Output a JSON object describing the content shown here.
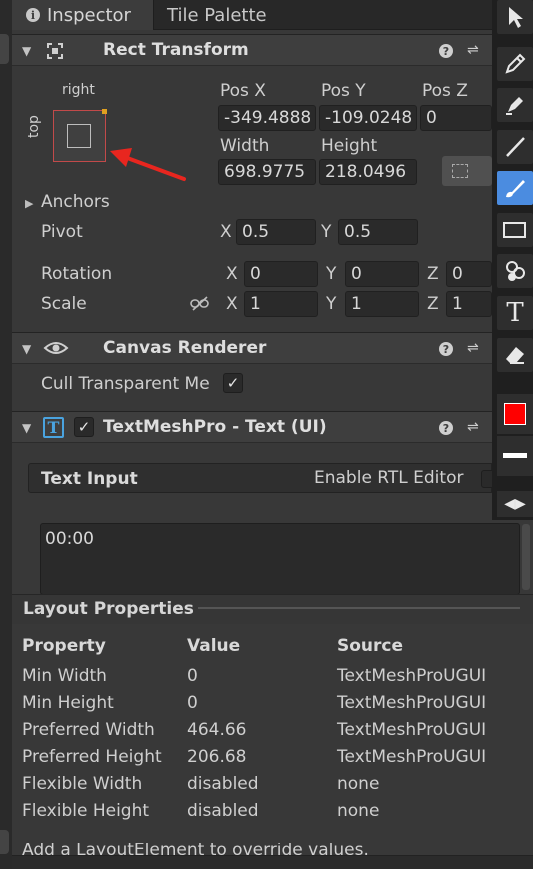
{
  "tabs": [
    {
      "label": "Inspector",
      "icon": "info-icon",
      "active": true
    },
    {
      "label": "Tile Palette",
      "active": false
    }
  ],
  "rect_transform": {
    "title": "Rect Transform",
    "anchor_preset": {
      "horizontal_label": "right",
      "vertical_label": "top"
    },
    "pos_x_label": "Pos X",
    "pos_x": "-349.4888",
    "pos_y_label": "Pos Y",
    "pos_y": "-109.0248",
    "pos_z_label": "Pos Z",
    "pos_z": "0",
    "width_label": "Width",
    "width": "698.9775",
    "height_label": "Height",
    "height": "218.0496",
    "anchors_label": "Anchors",
    "pivot_label": "Pivot",
    "pivot_x_label": "X",
    "pivot_x": "0.5",
    "pivot_y_label": "Y",
    "pivot_y": "0.5",
    "rotation_label": "Rotation",
    "rot_x_label": "X",
    "rot_x": "0",
    "rot_y_label": "Y",
    "rot_y": "0",
    "rot_z_label": "Z",
    "rot_z": "0",
    "scale_label": "Scale",
    "scale_x_label": "X",
    "scale_x": "1",
    "scale_y_label": "Y",
    "scale_y": "1",
    "scale_z_label": "Z",
    "scale_z": "1"
  },
  "canvas_renderer": {
    "title": "Canvas Renderer",
    "cull_label": "Cull Transparent Me",
    "cull_checked": true
  },
  "textmeshpro": {
    "title": "TextMeshPro - Text (UI)",
    "enabled": true,
    "text_input_label": "Text Input",
    "rtl_label": "Enable RTL Editor",
    "text_value": "00:00"
  },
  "layout_properties": {
    "title": "Layout Properties",
    "headers": [
      "Property",
      "Value",
      "Source"
    ],
    "rows": [
      [
        "Min Width",
        "0",
        "TextMeshProUGUI"
      ],
      [
        "Min Height",
        "0",
        "TextMeshProUGUI"
      ],
      [
        "Preferred Width",
        "464.66",
        "TextMeshProUGUI"
      ],
      [
        "Preferred Height",
        "206.68",
        "TextMeshProUGUI"
      ],
      [
        "Flexible Width",
        "disabled",
        "none"
      ],
      [
        "Flexible Height",
        "disabled",
        "none"
      ]
    ],
    "footer": "Add a LayoutElement to override values."
  },
  "tool_palette": {
    "tools": [
      "select-arrow-icon",
      "pencil-icon",
      "marker-icon",
      "line-icon",
      "brush-icon",
      "rectangle-icon",
      "stamp-icon",
      "text-tool-icon",
      "eraser-icon"
    ],
    "selected_tool": "brush-icon",
    "color_swatch": "#ff0000"
  },
  "annotation": {
    "arrow_color": "#e8261f"
  }
}
